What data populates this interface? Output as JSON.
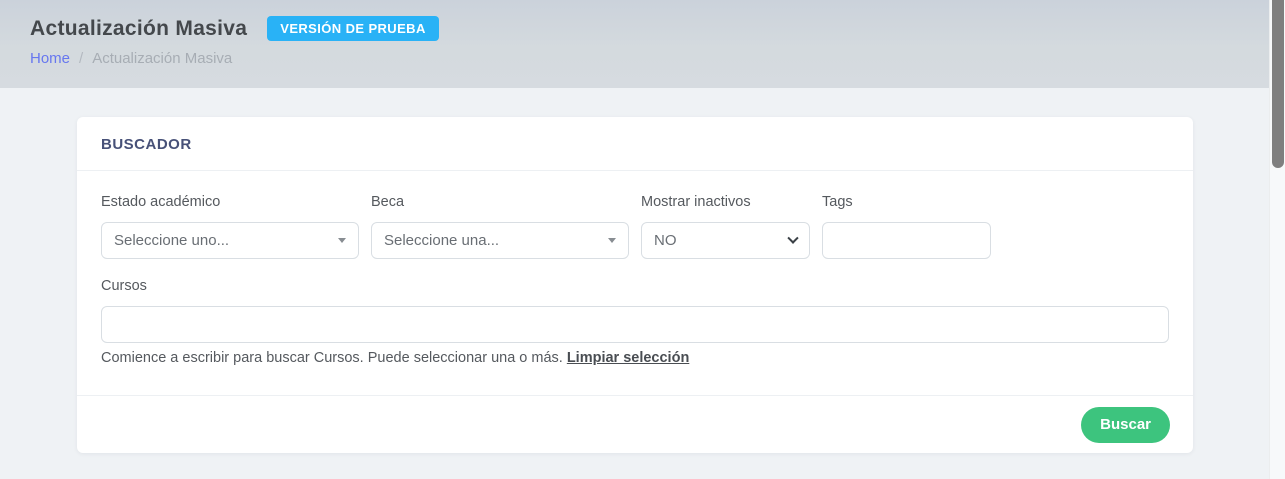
{
  "header": {
    "title": "Actualización Masiva",
    "badge": "VERSIÓN DE PRUEBA",
    "breadcrumb": {
      "home": "Home",
      "separator": "/",
      "current": "Actualización Masiva"
    }
  },
  "search_card": {
    "title": "BUSCADOR",
    "fields": {
      "estado_academico": {
        "label": "Estado académico",
        "value": "Seleccione uno..."
      },
      "beca": {
        "label": "Beca",
        "value": "Seleccione una..."
      },
      "mostrar_inactivos": {
        "label": "Mostrar inactivos",
        "value": "NO"
      },
      "tags": {
        "label": "Tags",
        "value": ""
      },
      "cursos": {
        "label": "Cursos",
        "value": "",
        "help_text": "Comience a escribir para buscar Cursos. Puede seleccionar una o más.",
        "clear_link": "Limpiar selección"
      }
    },
    "buscar_button": "Buscar"
  },
  "colors": {
    "badge_blue": "#29b2f6",
    "breadcrumb_link": "#6777ef",
    "card_title_navy": "#475178",
    "button_green": "#3dc47e",
    "header_band": "#d2d8e0",
    "page_background": "#eff2f5"
  }
}
